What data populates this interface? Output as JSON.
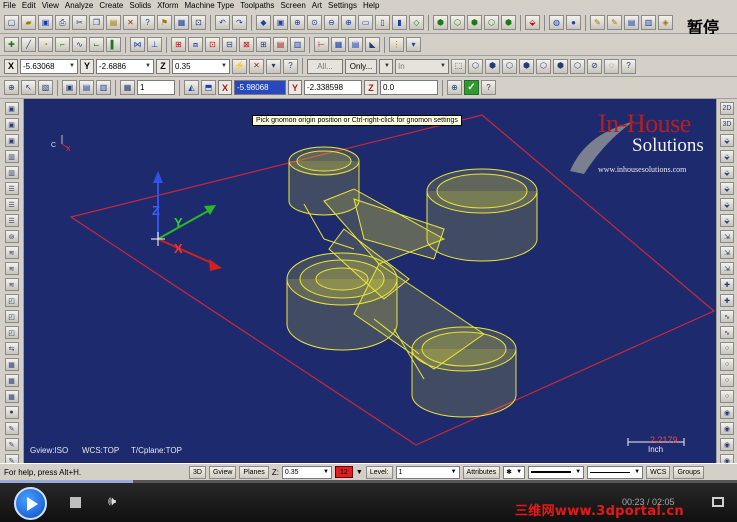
{
  "menu": [
    "File",
    "Edit",
    "View",
    "Analyze",
    "Create",
    "Solids",
    "Xform",
    "Machine Type",
    "Toolpaths",
    "Screen",
    "Art",
    "Settings",
    "Help"
  ],
  "overlay": {
    "pause_label": "暂停"
  },
  "toolbar_coords": {
    "x_label": "X",
    "x_value": "-5.63068",
    "y_label": "Y",
    "y_value": "-2.6886",
    "z_label": "Z",
    "z_value": "0.35",
    "filter_all": "All...",
    "filter_only": "Only...",
    "filter_in": "In"
  },
  "toolbar_gnomon": {
    "field_value": "1",
    "x_label": "X",
    "x_value": "-5.98068",
    "y_label": "Y",
    "y_value": "-2.338598",
    "z_label": "Z",
    "z_value": "0.0"
  },
  "viewport": {
    "tooltip": "Pick gnomon origin position or Ctrl-right-click for gnomon settings",
    "logo_main": "In-House",
    "logo_sub": "Solutions",
    "logo_url": "www.inhousesolutions.com",
    "gnomon_small": {
      "c": "C",
      "x": "X"
    },
    "axes": {
      "z": "Z",
      "y": "Y",
      "x": "X"
    },
    "gview": "Gview:ISO",
    "wcs": "WCS:TOP",
    "tcplane": "T/Cplane:TOP",
    "scale_value": "2.2179",
    "scale_unit": "Inch",
    "accent_colors": {
      "background": "#1e2a6e",
      "part": "#e8e63a",
      "plane": "#c8283a"
    }
  },
  "statusbar": {
    "help": "For help, press Alt+H.",
    "btn_3d": "3D",
    "btn_gview": "Gview",
    "btn_planes": "Planes",
    "z_label": "Z:",
    "z_value": "0.35",
    "color_value": "12",
    "level_label": "Level:",
    "level_value": "1",
    "attributes": "Attributes",
    "wcs": "WCS",
    "groups": "Groups"
  },
  "player": {
    "progress": 0.18,
    "watermark": "三维网www.3dportal.cn",
    "time": "00:23 / 02:05"
  }
}
